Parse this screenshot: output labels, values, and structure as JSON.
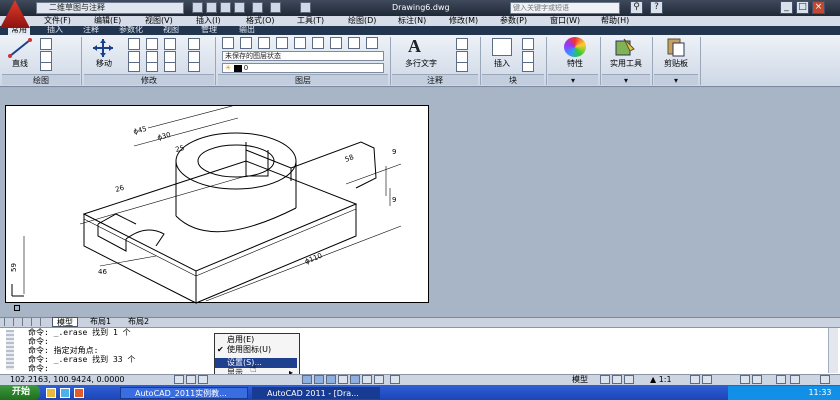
{
  "titlebar": {
    "workspace": "二维草图与注释",
    "document_title": "Drawing6.dwg",
    "search_placeholder": "键入关键字或短语"
  },
  "menu": [
    "文件(F)",
    "编辑(E)",
    "视图(V)",
    "插入(I)",
    "格式(O)",
    "工具(T)",
    "绘图(D)",
    "标注(N)",
    "修改(M)",
    "参数(P)",
    "窗口(W)",
    "帮助(H)"
  ],
  "ribbon_tabs": [
    "常用",
    "插入",
    "注释",
    "参数化",
    "视图",
    "管理",
    "输出"
  ],
  "ribbon": {
    "line_label": "直线",
    "move_label": "移动",
    "layer_state": "未保存的图层状态",
    "layer_current": "0",
    "mtext_label": "多行文字",
    "insert_label": "插入",
    "properties_label": "特性",
    "utilities_label": "实用工具",
    "clipboard_label": "剪贴板",
    "panels": [
      "绘图",
      "修改",
      "图层",
      "注释",
      "块"
    ]
  },
  "drawing": {
    "dims": [
      "ϕ45",
      "ϕ30",
      "25",
      "26",
      "58",
      "9",
      "9",
      "ϕ110",
      "46",
      "59"
    ]
  },
  "layout_tabs": [
    "模型",
    "布局1",
    "布局2"
  ],
  "command_lines": [
    "命令: _.erase 找到 1 个",
    "命令:",
    "命令: 指定对角点:",
    "命令: _.erase 找到 33 个",
    "命令:"
  ],
  "context_menu": {
    "items": [
      "启用(E)",
      "使用图标(U)",
      "设置(S)...",
      "显示"
    ]
  },
  "status": {
    "coords": "102.2163, 100.9424, 0.0000",
    "model_label": "模型",
    "scale": "1:1"
  },
  "taskbar": {
    "start": "开始",
    "tasks": [
      "AutoCAD_2011实例教...",
      "AutoCAD 2011 - [Dra..."
    ],
    "clock": "11:33"
  },
  "colors": {
    "title_bg": "#1f2836",
    "ribbon_tab_bg": "#23364f",
    "drawing_bg": "#a8b5c6",
    "menu_highlight": "#1f3f8f",
    "taskbar": "#2f5fd6"
  }
}
